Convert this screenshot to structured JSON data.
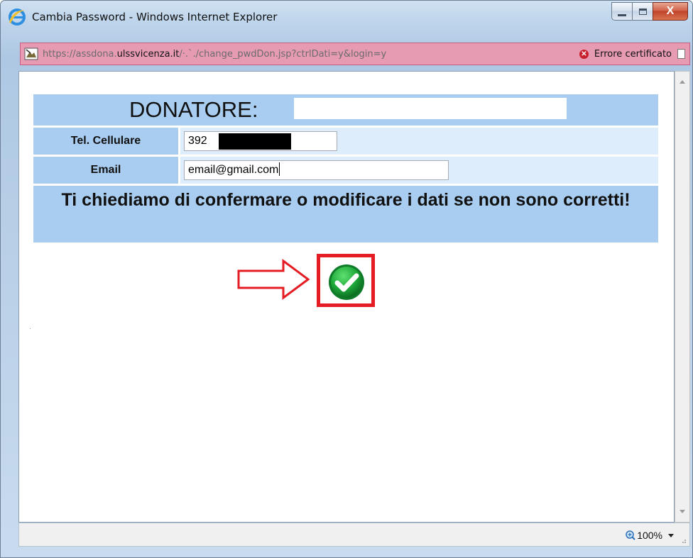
{
  "window": {
    "title": "Cambia Password - Windows Internet Explorer",
    "close_glyph": "X"
  },
  "addressbar": {
    "url_prefix": "https://assdona.",
    "url_domain": "ulssvicenza.it",
    "url_suffix": "/·.`./change_pwdDon.jsp?ctrlDati=y&login=y",
    "cert_error_label": "Errore certificato",
    "background_color": "#e69bb3"
  },
  "form": {
    "donor_label": "DONATORE:",
    "donor_value": "",
    "phone_label": "Tel. Cellulare",
    "phone_value": "392",
    "email_label": "Email",
    "email_value": "email@gmail.com",
    "message": "Ti chiediamo di confermare o modificare i dati se non sono corretti!",
    "header_color": "#a9cdf0",
    "row_color": "#deedfb"
  },
  "confirm": {
    "icon": "green-check-icon",
    "highlight_color": "#e51c23",
    "arrow_icon": "right-arrow-icon"
  },
  "statusbar": {
    "zoom_label": "100%"
  }
}
